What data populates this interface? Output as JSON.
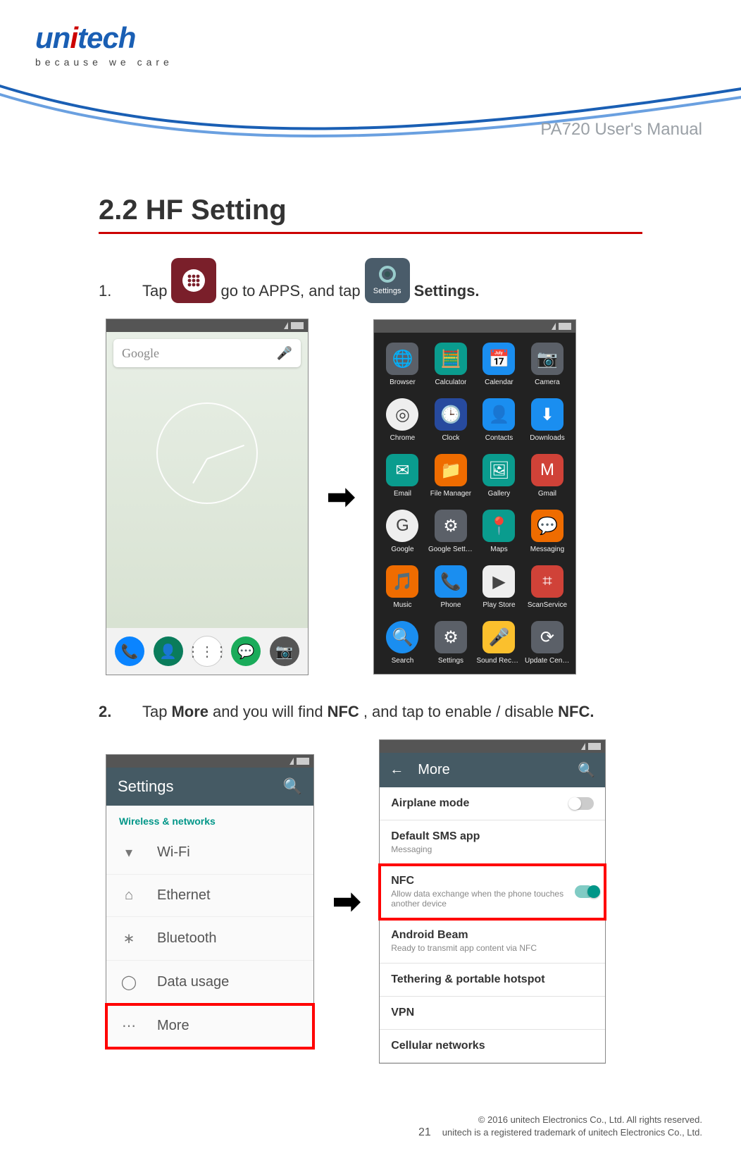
{
  "header": {
    "logo_main": "unitech",
    "tagline": "because we care",
    "manual_title": "PA720 User's Manual"
  },
  "section": {
    "title": "2.2 HF Setting"
  },
  "step1": {
    "num": "1.",
    "t1": "Tap",
    "t2": "go to APPS, and tap",
    "settings_icon_label": "Settings",
    "t3": "Settings."
  },
  "step2": {
    "num": "2.",
    "t1": "Tap",
    "w1": "More",
    "t2": "and you will find",
    "w2": "NFC",
    "t3": ", and tap to enable / disable",
    "w3": "NFC."
  },
  "homescreen": {
    "search_label": "Google"
  },
  "apps": [
    {
      "label": "Browser",
      "cls": "c-gray",
      "glyph": "🌐"
    },
    {
      "label": "Calculator",
      "cls": "c-teal",
      "glyph": "🧮"
    },
    {
      "label": "Calendar",
      "cls": "c-blue",
      "glyph": "📅"
    },
    {
      "label": "Camera",
      "cls": "c-gray",
      "glyph": "📷"
    },
    {
      "label": "Chrome",
      "cls": "c-white c-round",
      "glyph": "◎"
    },
    {
      "label": "Clock",
      "cls": "c-dblue",
      "glyph": "🕒"
    },
    {
      "label": "Contacts",
      "cls": "c-blue",
      "glyph": "👤"
    },
    {
      "label": "Downloads",
      "cls": "c-blue",
      "glyph": "⬇"
    },
    {
      "label": "Email",
      "cls": "c-teal",
      "glyph": "✉"
    },
    {
      "label": "File Manager",
      "cls": "c-orange",
      "glyph": "📁"
    },
    {
      "label": "Gallery",
      "cls": "c-teal",
      "glyph": "🖼"
    },
    {
      "label": "Gmail",
      "cls": "c-red",
      "glyph": "M"
    },
    {
      "label": "Google",
      "cls": "c-white c-round",
      "glyph": "G"
    },
    {
      "label": "Google Settings",
      "cls": "c-gray",
      "glyph": "⚙"
    },
    {
      "label": "Maps",
      "cls": "c-teal",
      "glyph": "📍"
    },
    {
      "label": "Messaging",
      "cls": "c-orange",
      "glyph": "💬"
    },
    {
      "label": "Music",
      "cls": "c-orange",
      "glyph": "🎵"
    },
    {
      "label": "Phone",
      "cls": "c-blue",
      "glyph": "📞"
    },
    {
      "label": "Play Store",
      "cls": "c-white",
      "glyph": "▶"
    },
    {
      "label": "ScanService",
      "cls": "c-red",
      "glyph": "⌗"
    },
    {
      "label": "Search",
      "cls": "c-blue c-round",
      "glyph": "🔍"
    },
    {
      "label": "Settings",
      "cls": "c-gray",
      "glyph": "⚙"
    },
    {
      "label": "Sound Recorder",
      "cls": "c-yellow",
      "glyph": "🎤"
    },
    {
      "label": "Update Center",
      "cls": "c-gray",
      "glyph": "⟳"
    }
  ],
  "settings_screen": {
    "title": "Settings",
    "section_label": "Wireless & networks",
    "rows": [
      {
        "icon": "▾",
        "label": "Wi-Fi"
      },
      {
        "icon": "⌂",
        "label": "Ethernet"
      },
      {
        "icon": "∗",
        "label": "Bluetooth"
      },
      {
        "icon": "◯",
        "label": "Data usage"
      },
      {
        "icon": "⋯",
        "label": "More"
      }
    ],
    "highlight_index": 4
  },
  "more_screen": {
    "title": "More",
    "rows": [
      {
        "title": "Airplane mode",
        "sub": "",
        "toggle": "off"
      },
      {
        "title": "Default SMS app",
        "sub": "Messaging"
      },
      {
        "title": "NFC",
        "sub": "Allow data exchange when the phone touches another device",
        "toggle": "on",
        "highlight": true
      },
      {
        "title": "Android Beam",
        "sub": "Ready to transmit app content via NFC"
      },
      {
        "title": "Tethering & portable hotspot",
        "sub": ""
      },
      {
        "title": "VPN",
        "sub": ""
      },
      {
        "title": "Cellular networks",
        "sub": "",
        "faint": true
      }
    ]
  },
  "footer": {
    "page": "21",
    "line1": "© 2016 unitech Electronics Co., Ltd. All rights reserved.",
    "line2": "unitech is a registered trademark of unitech Electronics Co., Ltd."
  }
}
